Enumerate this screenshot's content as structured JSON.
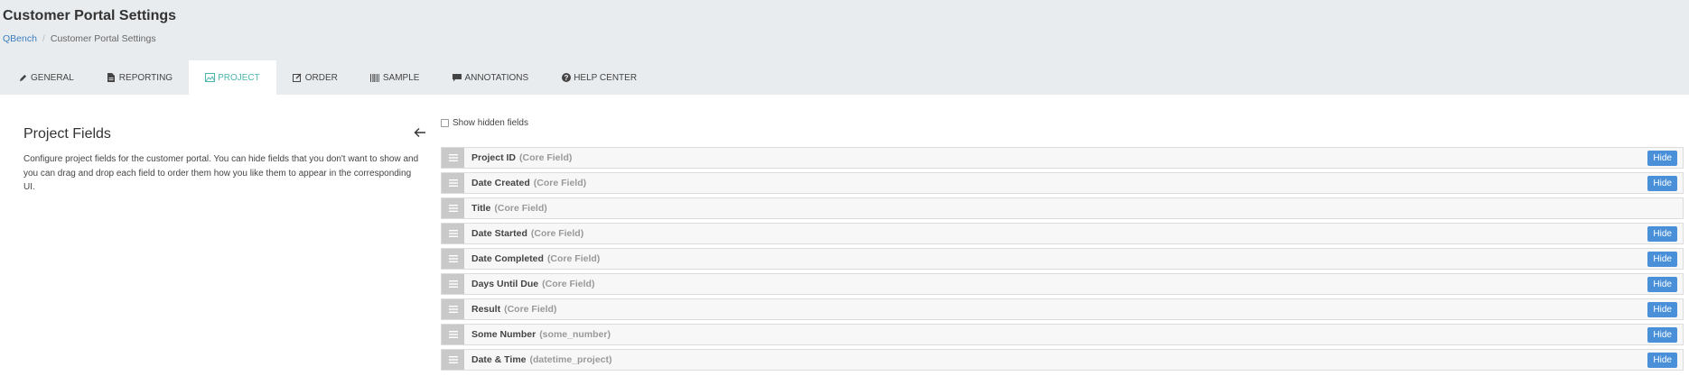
{
  "header": {
    "title": "Customer Portal Settings",
    "breadcrumb": [
      {
        "label": "QBench"
      },
      {
        "label": "Customer Portal Settings"
      }
    ]
  },
  "tabs": [
    {
      "label": "GENERAL",
      "icon": "pencil-icon",
      "active": false
    },
    {
      "label": "REPORTING",
      "icon": "document-icon",
      "active": false
    },
    {
      "label": "PROJECT",
      "icon": "project-icon",
      "active": true
    },
    {
      "label": "ORDER",
      "icon": "edit-icon",
      "active": false
    },
    {
      "label": "SAMPLE",
      "icon": "barcode-icon",
      "active": false
    },
    {
      "label": "ANNOTATIONS",
      "icon": "comment-icon",
      "active": false
    },
    {
      "label": "HELP CENTER",
      "icon": "question-icon",
      "active": false
    }
  ],
  "section": {
    "title": "Project Fields",
    "description": "Configure project fields for the customer portal. You can hide fields that you don't want to show and you can drag and drop each field to order them how you like them to appear in the corresponding UI."
  },
  "show_hidden": {
    "label": "Show hidden fields",
    "checked": false
  },
  "fields": [
    {
      "name": "Project ID",
      "type": "(Core Field)",
      "hide_label": "Hide"
    },
    {
      "name": "Date Created",
      "type": "(Core Field)",
      "hide_label": "Hide"
    },
    {
      "name": "Title",
      "type": "(Core Field)",
      "hide_label": ""
    },
    {
      "name": "Date Started",
      "type": "(Core Field)",
      "hide_label": "Hide"
    },
    {
      "name": "Date Completed",
      "type": "(Core Field)",
      "hide_label": "Hide"
    },
    {
      "name": "Days Until Due",
      "type": "(Core Field)",
      "hide_label": "Hide"
    },
    {
      "name": "Result",
      "type": "(Core Field)",
      "hide_label": "Hide"
    },
    {
      "name": "Some Number",
      "type": "(some_number)",
      "hide_label": "Hide"
    },
    {
      "name": "Date & Time",
      "type": "(datetime_project)",
      "hide_label": "Hide"
    }
  ],
  "colors": {
    "header_bg": "#e9ecef",
    "active_tab": "#4db6ac",
    "hide_button": "#4a90d9",
    "link": "#3a7ebf"
  }
}
